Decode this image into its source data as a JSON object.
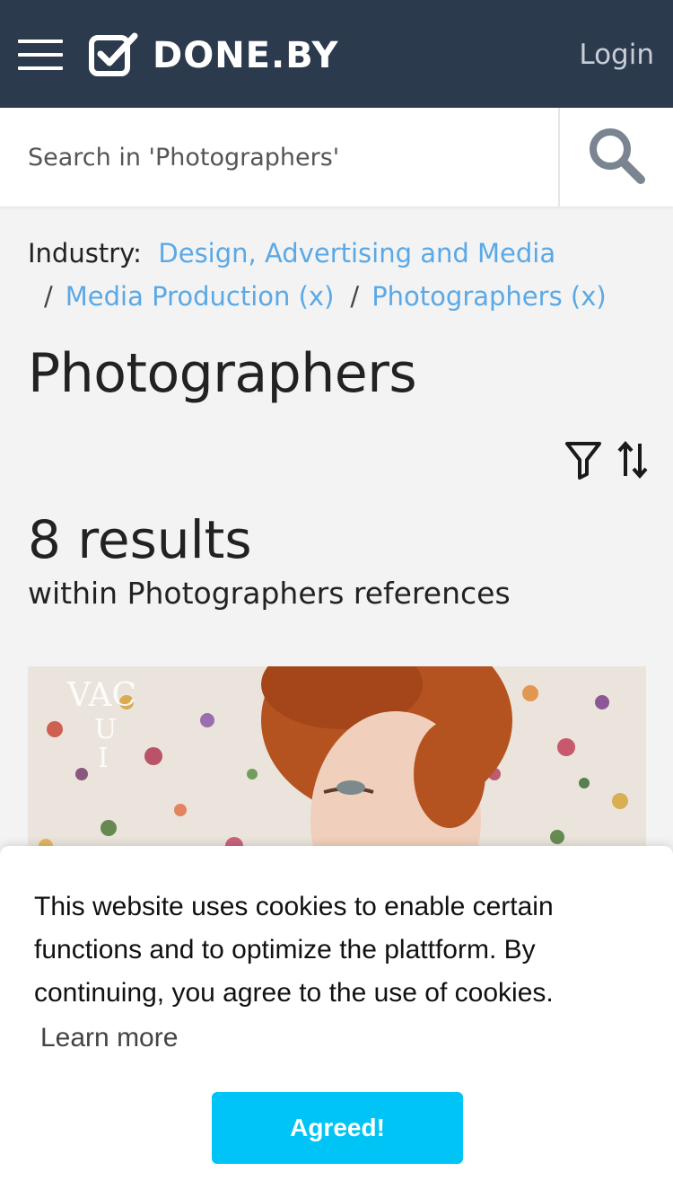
{
  "header": {
    "brand": "DONE.BY",
    "login_label": "Login",
    "menu_icon": "hamburger-menu-icon",
    "logo_icon": "checkbox-logo-icon"
  },
  "search": {
    "placeholder": "Search in 'Photographers'",
    "icon": "search-icon"
  },
  "breadcrumb": {
    "label": "Industry:",
    "items": [
      {
        "label": "Design, Advertising and Media"
      },
      {
        "label": "Media Production (x)"
      },
      {
        "label": "Photographers (x)"
      }
    ],
    "separator": "/"
  },
  "page": {
    "title": "Photographers",
    "results_count": "8 results",
    "results_subtitle": "within Photographers references"
  },
  "toolbar": {
    "filter_icon": "filter-icon",
    "sort_icon": "sort-arrows-icon"
  },
  "card": {
    "image_text": "VAC UI"
  },
  "cookie": {
    "message": "This website uses cookies to enable certain functions and to optimize the plattform. By continuing, you agree to the use of cookies.",
    "learn_more": "Learn more",
    "agree_label": "Agreed!"
  },
  "colors": {
    "header_bg": "#2c3a4d",
    "link": "#5aa9e6",
    "accent_button": "#00c4f5",
    "page_bg": "#f3f3f3"
  }
}
